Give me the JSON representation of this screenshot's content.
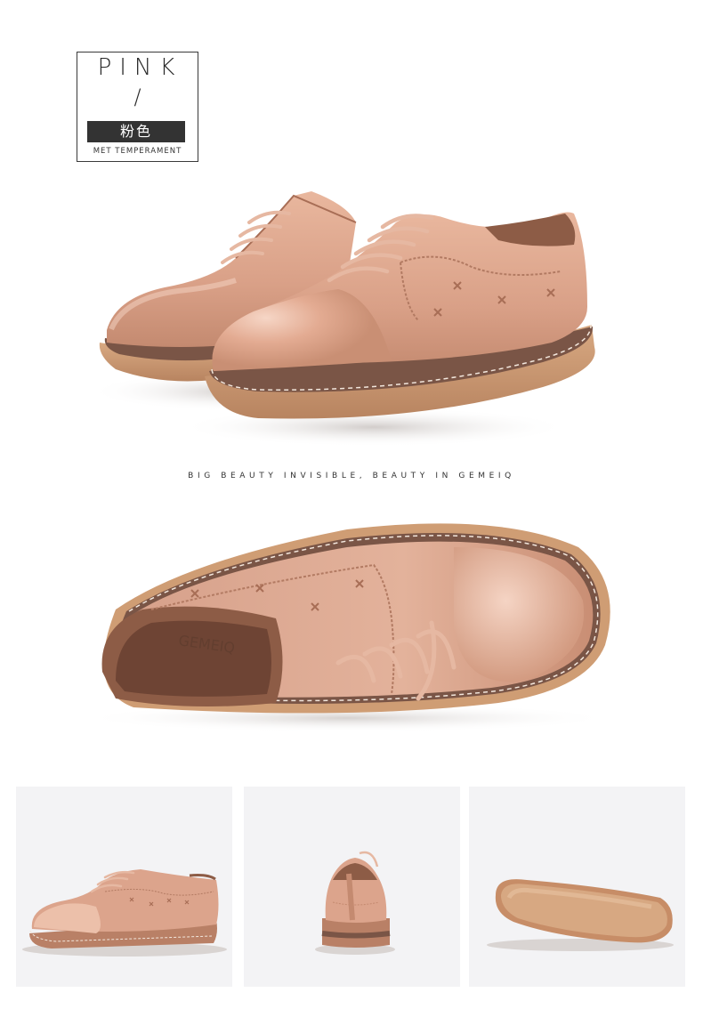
{
  "title": {
    "english": "PINK",
    "slash": "/",
    "chinese": "粉色",
    "subtitle": "MET TEMPERAMENT"
  },
  "tagline": "BIG BEAUTY INVISIBLE, BEAUTY IN GEMEIQ",
  "insole_brand": "GEMEIQ",
  "colors": {
    "leather": "#dca48c",
    "leather_dark": "#b98066",
    "sole": "#cf9d74",
    "thumb_background": "#f3f3f5",
    "title_bar": "#333333"
  },
  "photos": {
    "hero": "shoe-pair-three-quarter",
    "top_view": "shoe-top-view",
    "thumbnails": [
      "shoe-side-view",
      "shoe-back-view",
      "shoe-sole-view"
    ]
  }
}
